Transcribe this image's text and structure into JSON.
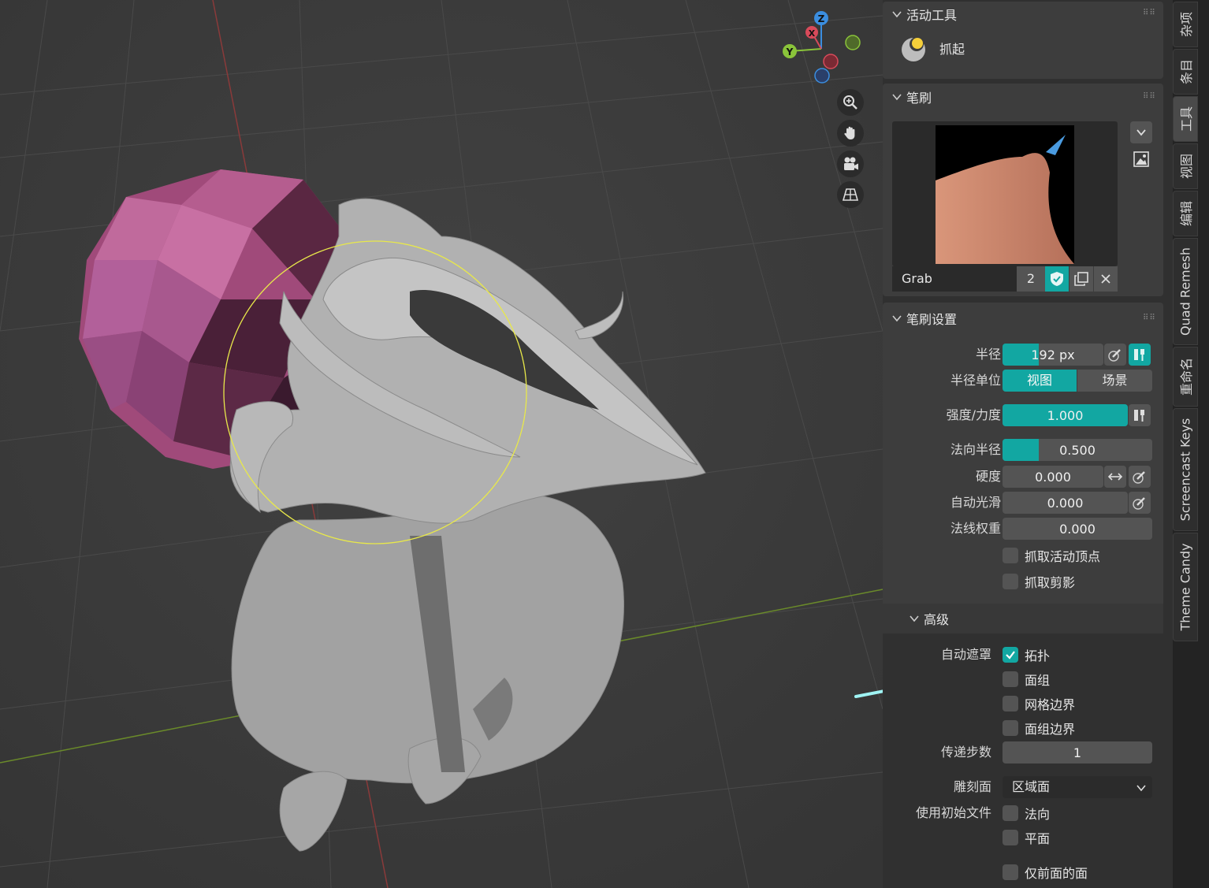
{
  "viewport": {
    "gizmo": {
      "z": "Z",
      "x": "X",
      "y": "Y"
    }
  },
  "active_tool": {
    "header": "活动工具",
    "name": "抓起"
  },
  "brush": {
    "header": "笔刷",
    "name": "Grab",
    "users": "2"
  },
  "brush_settings": {
    "header": "笔刷设置",
    "radius_label": "半径",
    "radius_value": "192 px",
    "radius_unit_label": "半径单位",
    "radius_unit_options": [
      "视图",
      "场景"
    ],
    "strength_label": "强度/力度",
    "strength_value": "1.000",
    "normal_radius_label": "法向半径",
    "normal_radius_value": "0.500",
    "hardness_label": "硬度",
    "hardness_value": "0.000",
    "autosmooth_label": "自动光滑",
    "autosmooth_value": "0.000",
    "normal_weight_label": "法线权重",
    "normal_weight_value": "0.000",
    "grab_active_vertex": "抓取活动顶点",
    "grab_silhouette": "抓取剪影"
  },
  "advanced": {
    "header": "高级",
    "automasking_label": "自动遮罩",
    "automasking_options": [
      {
        "label": "拓扑",
        "checked": true
      },
      {
        "label": "面组",
        "checked": false
      },
      {
        "label": "网格边界",
        "checked": false
      },
      {
        "label": "面组边界",
        "checked": false
      }
    ],
    "propagation_label": "传递步数",
    "propagation_value": "1",
    "sculpt_plane_label": "雕刻面",
    "sculpt_plane_value": "区域面",
    "use_original_label": "使用初始文件",
    "use_original_options": [
      {
        "label": "法向",
        "checked": false
      },
      {
        "label": "平面",
        "checked": false
      }
    ],
    "front_faces_only": "仅前面的面"
  },
  "tabs": [
    "杂项",
    "条目",
    "工具",
    "视图",
    "编辑",
    "Quad Remesh",
    "重命名",
    "Screencast Keys",
    "Theme Candy"
  ],
  "colors": {
    "accent": "#12a7a2",
    "brush_cursor": "#e8e84a",
    "arrow": "#9ff4f4",
    "sphere": "#b5568f"
  }
}
